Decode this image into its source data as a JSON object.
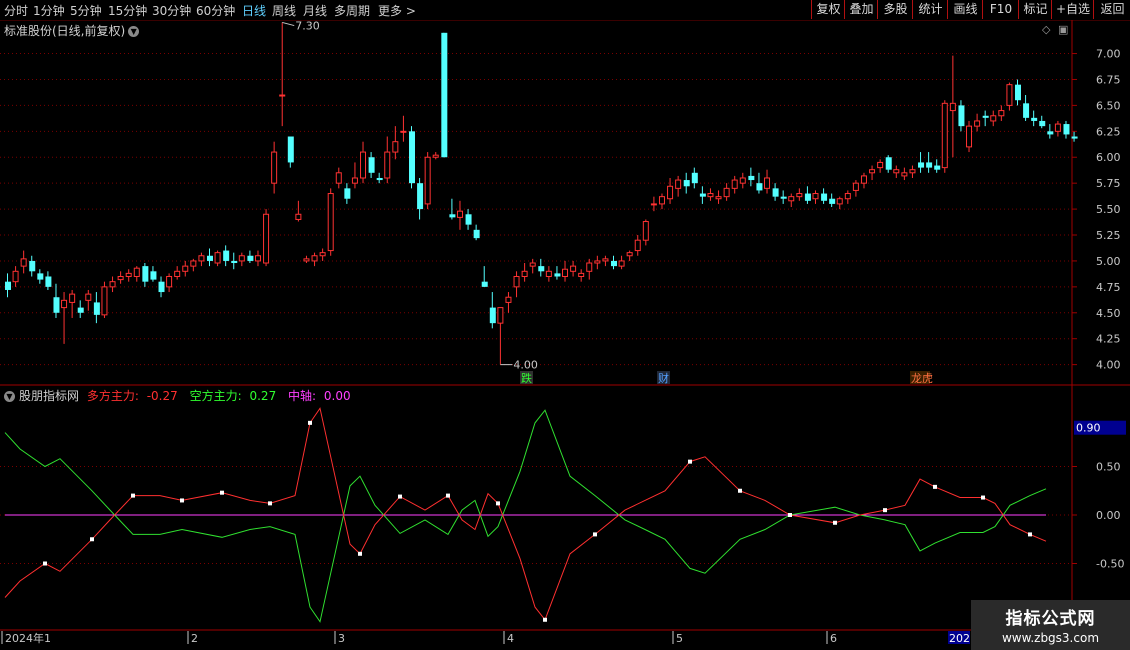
{
  "toolbar": {
    "periods": [
      "分时",
      "1分钟",
      "5分钟",
      "15分钟",
      "30分钟",
      "60分钟",
      "日线",
      "周线",
      "月线",
      "多周期",
      "更多"
    ],
    "more_arrow": ">",
    "active_period": "日线",
    "right_buttons": [
      "复权",
      "叠加",
      "多股",
      "统计",
      "画线",
      "F10",
      "标记",
      "+自选",
      "返回"
    ]
  },
  "main_chart": {
    "stock_name": "标准股份(日线,前复权)",
    "price_ticks": [
      "7.00",
      "6.75",
      "6.50",
      "6.25",
      "6.00",
      "5.75",
      "5.50",
      "5.25",
      "5.00",
      "4.75",
      "4.50",
      "4.25",
      "4.00"
    ],
    "high_label": "7.30",
    "low_label": "4.00",
    "event_markers": [
      "跌",
      "财",
      "龙虎"
    ],
    "colors": {
      "up": "#ff3232",
      "down": "#54ffff",
      "grid": "#7a0000"
    }
  },
  "indicator": {
    "name": "股朋指标网",
    "series": [
      {
        "label": "多方主力:",
        "value": "-0.27",
        "color": "#ff3030"
      },
      {
        "label": "空方主力:",
        "value": "0.27",
        "color": "#30ff30"
      },
      {
        "label": "中轴:",
        "value": "0.00",
        "color": "#ff40ff"
      }
    ],
    "y_ticks": [
      "0.50",
      "0.00",
      "-0.50"
    ],
    "current_value": "0.90"
  },
  "time_axis": {
    "labels": [
      "2024年1",
      "2",
      "3",
      "4",
      "5",
      "6"
    ],
    "end_label": "202"
  },
  "watermark": {
    "title": "指标公式网",
    "url": "www.zbgs3.com"
  }
}
